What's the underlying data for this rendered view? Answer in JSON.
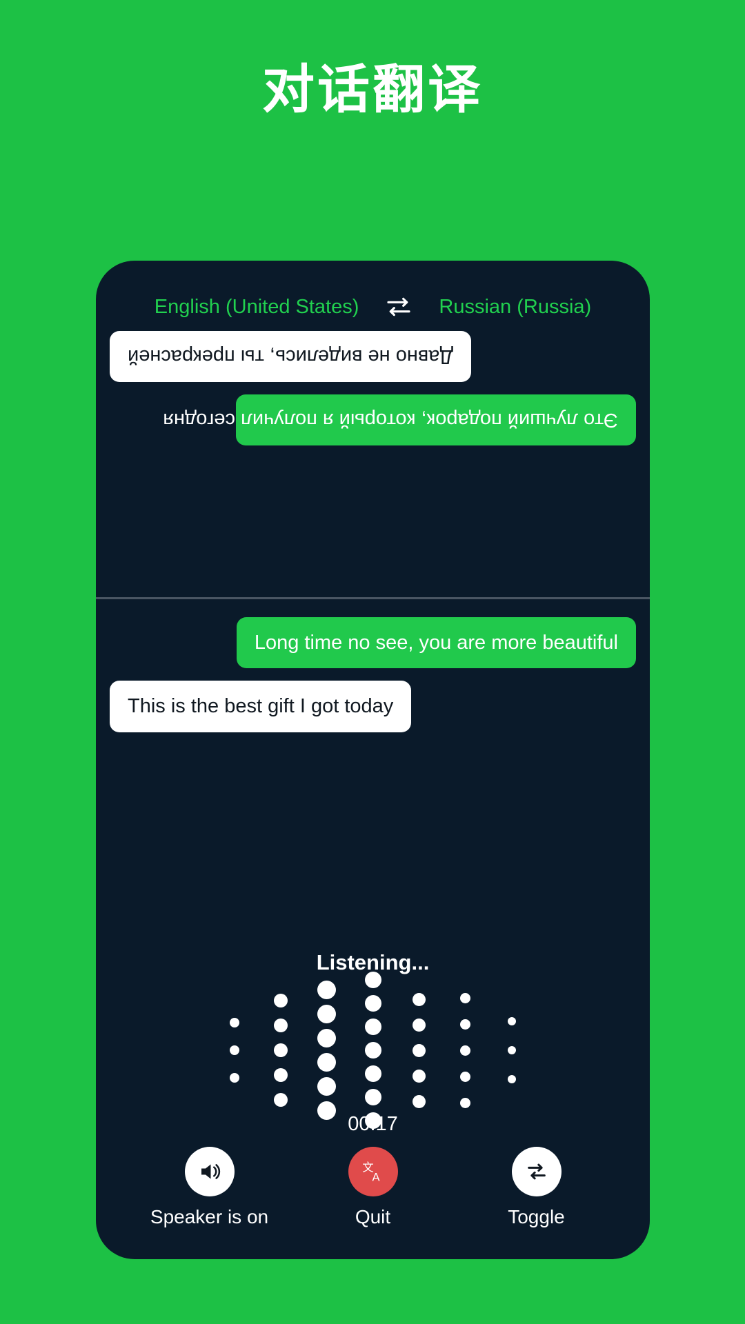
{
  "theme": {
    "page_bg": "#1DC145",
    "panel_bg": "#0A1A2A",
    "accent_green": "#21C94C",
    "lang_green": "#21D14F",
    "bubble_white": "#FFFFFF",
    "quit_red": "#E04B4B",
    "divider": "#4A5663",
    "text_white": "#FFFFFF"
  },
  "header": {
    "title": "对话翻译"
  },
  "language_bar": {
    "source_language": "English (United States)",
    "swap_icon": "swap-horizontal-icon",
    "target_language": "Russian (Russia)"
  },
  "conversation": {
    "top_pane": {
      "rotated": true,
      "language": "Russian (Russia)",
      "messages": [
        {
          "text": "Это лучший подарок, который я получил сегодня",
          "style": "accent",
          "align": "left"
        },
        {
          "text": "Давно не виделись, ты прекрасней",
          "style": "plain",
          "align": "right"
        }
      ]
    },
    "bottom_pane": {
      "rotated": false,
      "language": "English (United States)",
      "messages": [
        {
          "text": "Long time no see, you are more beautiful",
          "style": "accent",
          "align": "right"
        },
        {
          "text": "This is the best gift I got today",
          "style": "plain",
          "align": "left"
        }
      ]
    }
  },
  "listening": {
    "status_label": "Listening...",
    "timer": "00:17",
    "waveform": {
      "dot_color": "#FFFFFF",
      "columns": [
        {
          "dot_count": 3,
          "dot_size": 14,
          "gap": 26
        },
        {
          "dot_count": 5,
          "dot_size": 20,
          "gap": 16
        },
        {
          "dot_count": 6,
          "dot_size": 27,
          "gap": 8
        },
        {
          "dot_count": 7,
          "dot_size": 24,
          "gap": 10
        },
        {
          "dot_count": 5,
          "dot_size": 19,
          "gap": 18
        },
        {
          "dot_count": 5,
          "dot_size": 15,
          "gap": 23
        },
        {
          "dot_count": 3,
          "dot_size": 12,
          "gap": 30
        }
      ]
    }
  },
  "controls": [
    {
      "icon": "speaker-on-icon",
      "label": "Speaker is on",
      "circle_style": "white"
    },
    {
      "icon": "translate-icon",
      "label": "Quit",
      "circle_style": "red"
    },
    {
      "icon": "toggle-swap-icon",
      "label": "Toggle",
      "circle_style": "white"
    }
  ]
}
